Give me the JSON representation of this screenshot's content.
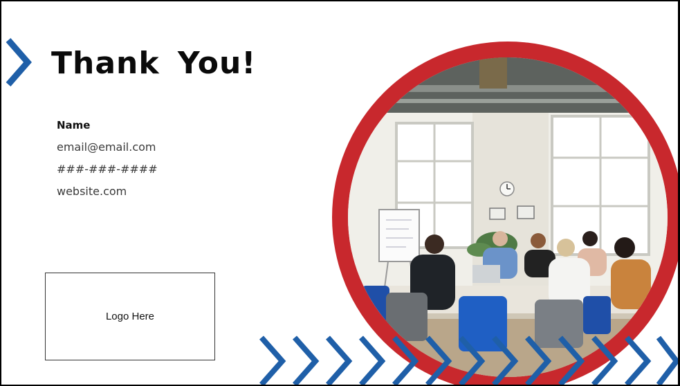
{
  "title": "Thank You!",
  "contact": {
    "name": "Name",
    "email": "email@email.com",
    "phone": "###-###-####",
    "website": "website.com"
  },
  "logo": {
    "placeholder": "Logo Here"
  },
  "photo": {
    "icon": "meeting-room-photo"
  },
  "colors": {
    "accent_blue": "#1f5fa8",
    "accent_red": "#c8282d",
    "text_dark": "#0a0a0a"
  }
}
